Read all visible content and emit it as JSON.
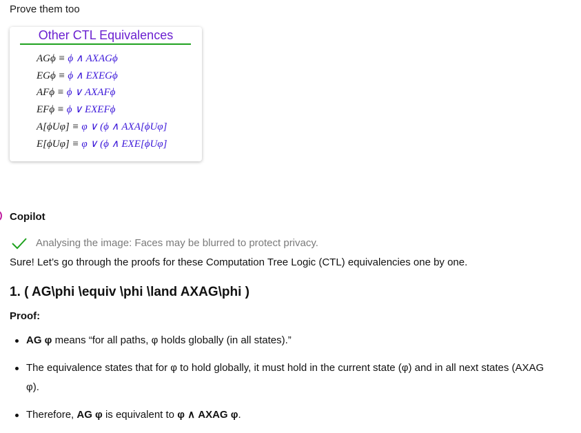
{
  "user_message": "Prove them too",
  "image_card": {
    "title": "Other CTL Equivalences",
    "equations": [
      {
        "left": "AGϕ ≡ ",
        "right": "ϕ ∧ AXAGϕ"
      },
      {
        "left": "EGϕ ≡ ",
        "right": "ϕ ∧ EXEGϕ"
      },
      {
        "left": "AFϕ ≡ ",
        "right": "ϕ ∨ AXAFϕ"
      },
      {
        "left": "EFϕ ≡ ",
        "right": "ϕ ∨ EXEFϕ"
      },
      {
        "left": "A[ϕUφ] ≡ ",
        "right": "φ ∨ (ϕ ∧ AXA[ϕUφ]"
      },
      {
        "left": "E[ϕUφ] ≡ ",
        "right": "φ ∨ (ϕ ∧ EXE[ϕUφ]"
      }
    ],
    "colors": {
      "title": "#6a1fd0",
      "rule": "#1fa21f",
      "rhs": "#3a16d8"
    }
  },
  "assistant": {
    "name": "Copilot",
    "status": "Analysing the image: Faces may be blurred to protect privacy.",
    "intro": "Sure! Let’s go through the proofs for these Computation Tree Logic (CTL) equivalencies one by one.",
    "heading": "1. ( AG\\phi \\equiv \\phi \\land AXAG\\phi )",
    "proof_label": "Proof:",
    "bullets": [
      {
        "b1": "AG φ",
        "t1": " means “for all paths, φ holds globally (in all states).”"
      },
      {
        "t1": "The equivalence states that for φ to hold globally, it must hold in the current state (φ) and in all next states (AXAG φ)."
      },
      {
        "t1": "Therefore, ",
        "b1": "AG φ",
        "t2": " is equivalent to ",
        "b2": "φ ∧ AXAG φ",
        "t3": "."
      }
    ]
  },
  "icons": [
    "check-icon"
  ]
}
